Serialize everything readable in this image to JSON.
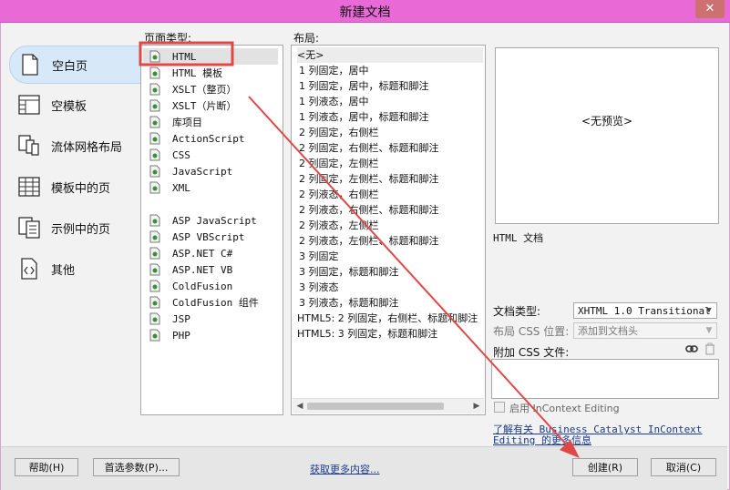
{
  "window": {
    "title": "新建文档",
    "close_glyph": "✕"
  },
  "categories": [
    {
      "label": "空白页",
      "icon": "blank-page-icon",
      "selected": true
    },
    {
      "label": "空模板",
      "icon": "blank-template-icon",
      "selected": false
    },
    {
      "label": "流体网格布局",
      "icon": "fluid-grid-icon",
      "selected": false
    },
    {
      "label": "模板中的页",
      "icon": "template-page-icon",
      "selected": false
    },
    {
      "label": "示例中的页",
      "icon": "sample-page-icon",
      "selected": false
    },
    {
      "label": "其他",
      "icon": "other-icon",
      "selected": false
    }
  ],
  "page_type": {
    "heading": "页面类型:",
    "items": [
      "HTML",
      "HTML 模板",
      "XSLT（整页）",
      "XSLT（片断）",
      "库项目",
      "ActionScript",
      "CSS",
      "JavaScript",
      "XML",
      "",
      "ASP JavaScript",
      "ASP VBScript",
      "ASP.NET C#",
      "ASP.NET VB",
      "ColdFusion",
      "ColdFusion 组件",
      "JSP",
      "PHP"
    ],
    "selected": "HTML"
  },
  "layout": {
    "heading": "布局:",
    "items": [
      "<无>",
      "1 列固定，居中",
      "1 列固定，居中，标题和脚注",
      "1 列液态，居中",
      "1 列液态，居中，标题和脚注",
      "2 列固定，右侧栏",
      "2 列固定，右侧栏、标题和脚注",
      "2 列固定，左侧栏",
      "2 列固定，左侧栏、标题和脚注",
      "2 列液态，右侧栏",
      "2 列液态，右侧栏、标题和脚注",
      "2 列液态，左侧栏",
      "2 列液态，左侧栏、标题和脚注",
      "3 列固定",
      "3 列固定，标题和脚注",
      "3 列液态",
      "3 列液态，标题和脚注",
      "HTML5: 2 列固定，右侧栏、标题和脚注",
      "HTML5: 3 列固定，标题和脚注"
    ],
    "selected": "<无>"
  },
  "preview": {
    "text": "<无预览>",
    "description": "HTML 文档"
  },
  "doctype": {
    "label": "文档类型:",
    "value": "XHTML 1.0 Transitional"
  },
  "css_position": {
    "label": "布局 CSS 位置:",
    "value": "添加到文档头"
  },
  "attach_css": {
    "label": "附加 CSS 文件:",
    "link_icon": "link-icon",
    "trash_icon": "trash-icon"
  },
  "incontext": {
    "label": "启用 InContext Editing",
    "checked": false
  },
  "help_link": {
    "line1": "了解有关 Business Catalyst InContext",
    "line2": "Editing 的更多信息"
  },
  "buttons": {
    "help": "帮助(H)",
    "prefs": "首选参数(P)...",
    "more_content": "获取更多内容...",
    "create": "创建(R)",
    "cancel": "取消(C)"
  },
  "annotation": {
    "color": "#e04848"
  }
}
